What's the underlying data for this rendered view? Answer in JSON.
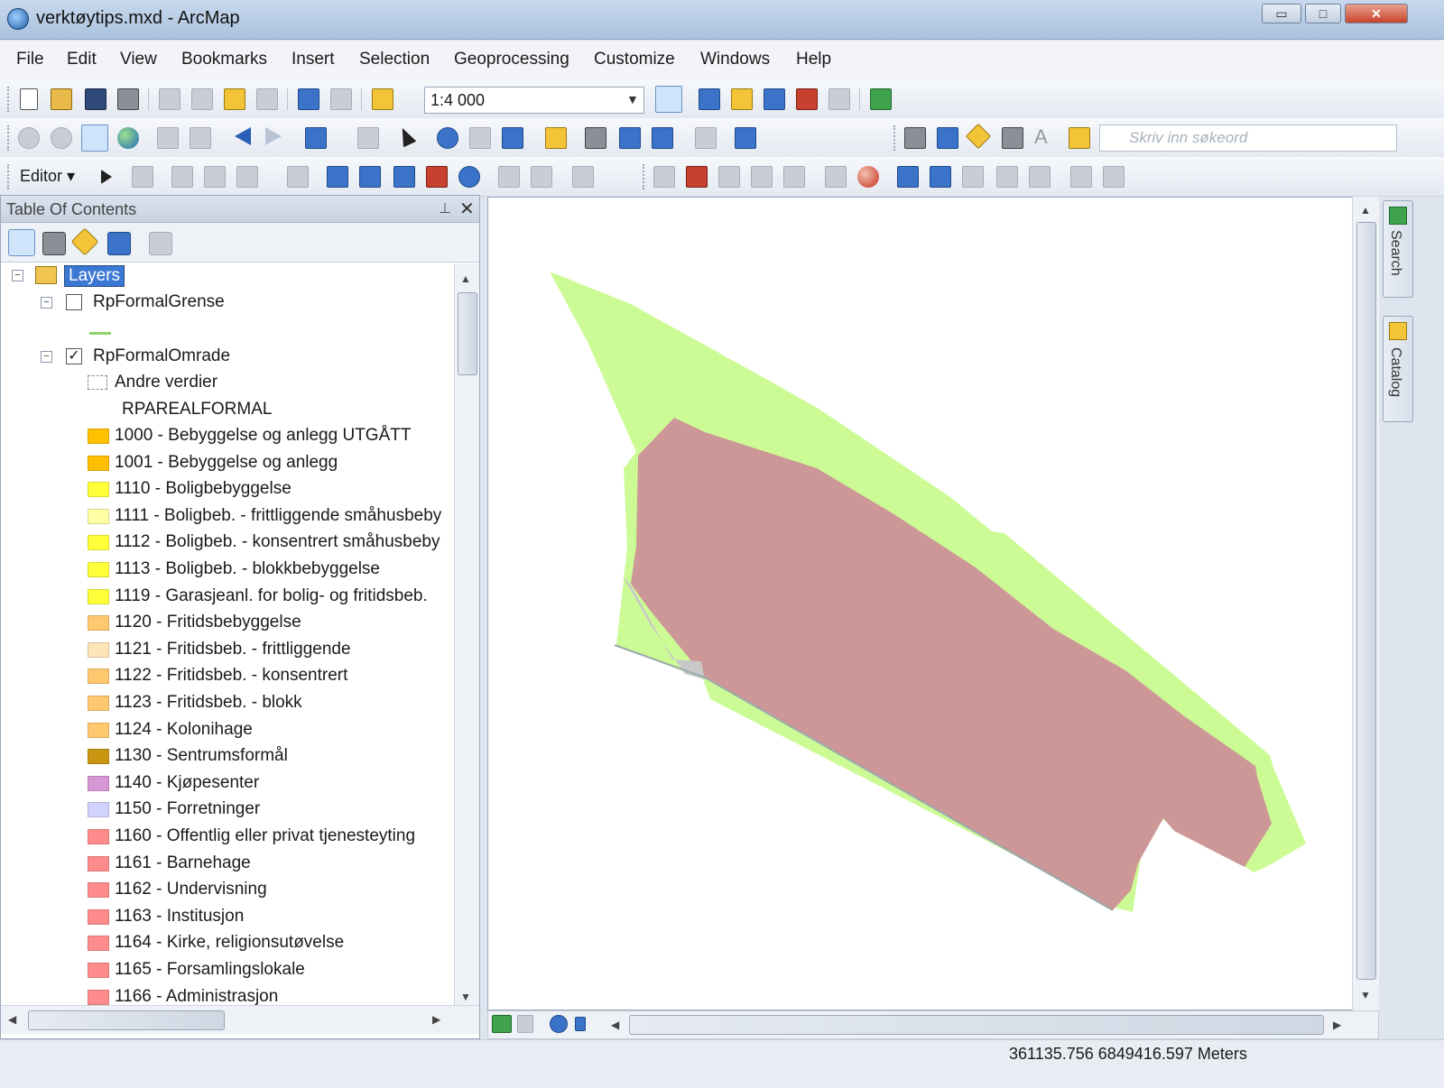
{
  "window": {
    "title": "verktøytips.mxd - ArcMap",
    "minimize": "▭",
    "maximize": "□",
    "close": "✕"
  },
  "menu": [
    "File",
    "Edit",
    "View",
    "Bookmarks",
    "Insert",
    "Selection",
    "Geoprocessing",
    "Customize",
    "Windows",
    "Help"
  ],
  "toolbar": {
    "scale": "1:4 000",
    "search_placeholder": "Skriv inn søkeord",
    "editor_label": "Editor ▾"
  },
  "toc": {
    "title": "Table Of Contents",
    "pin": "⊥",
    "close": "✕",
    "root_label": "Layers",
    "layer1": {
      "name": "RpFormalGrense",
      "checked": false,
      "line_color": "#8fd16a"
    },
    "layer2": {
      "name": "RpFormalOmrade",
      "checked": true,
      "check_mark": "✓",
      "other_values": "Andre verdier",
      "field": "RPAREALFORMAL"
    },
    "classes": [
      {
        "label": "1000 - Bebyggelse og anlegg UTGÅTT",
        "color": "#ffc000"
      },
      {
        "label": "1001 - Bebyggelse og anlegg",
        "color": "#ffbe00"
      },
      {
        "label": "1110 - Boligbebyggelse",
        "color": "#ffff3a"
      },
      {
        "label": "1111 - Boligbeb. - frittliggende småhusbeby",
        "color": "#ffffa6"
      },
      {
        "label": "1112 - Boligbeb. - konsentrert småhusbeby",
        "color": "#ffff3a"
      },
      {
        "label": "1113 - Boligbeb. - blokkbebyggelse",
        "color": "#ffff3a"
      },
      {
        "label": "1119 - Garasjeanl. for bolig- og fritidsbeb.",
        "color": "#ffff3a"
      },
      {
        "label": "1120 - Fritidsbebyggelse",
        "color": "#ffc86e"
      },
      {
        "label": "1121 - Fritidsbeb. - frittliggende",
        "color": "#ffe4b8"
      },
      {
        "label": "1122 - Fritidsbeb. - konsentrert",
        "color": "#ffc86e"
      },
      {
        "label": "1123 - Fritidsbeb. - blokk",
        "color": "#ffc86e"
      },
      {
        "label": "1124 - Kolonihage",
        "color": "#ffc86e"
      },
      {
        "label": "1130 - Sentrumsformål",
        "color": "#c89610"
      },
      {
        "label": "1140 - Kjøpesenter",
        "color": "#d796d4"
      },
      {
        "label": "1150 - Forretninger",
        "color": "#d2d2ff"
      },
      {
        "label": "1160 - Offentlig eller privat tjenesteyting",
        "color": "#ff8c8c"
      },
      {
        "label": "1161 - Barnehage",
        "color": "#ff8c8c"
      },
      {
        "label": "1162 - Undervisning",
        "color": "#ff8c8c"
      },
      {
        "label": "1163 - Institusjon",
        "color": "#ff8c8c"
      },
      {
        "label": "1164 - Kirke, religionsutøvelse",
        "color": "#ff8c8c"
      },
      {
        "label": "1165 - Forsamlingslokale",
        "color": "#ff8c8c"
      },
      {
        "label": "1166 - Administrasjon",
        "color": "#ff8c8c"
      }
    ]
  },
  "map": {
    "green_fill": "#ccfb95",
    "pink_fill": "#cd9797",
    "gray_fill": "#c8c8c8"
  },
  "dock": {
    "search": "Search",
    "catalog": "Catalog"
  },
  "status": {
    "coordinates": "361135.756  6849416.597 Meters"
  }
}
